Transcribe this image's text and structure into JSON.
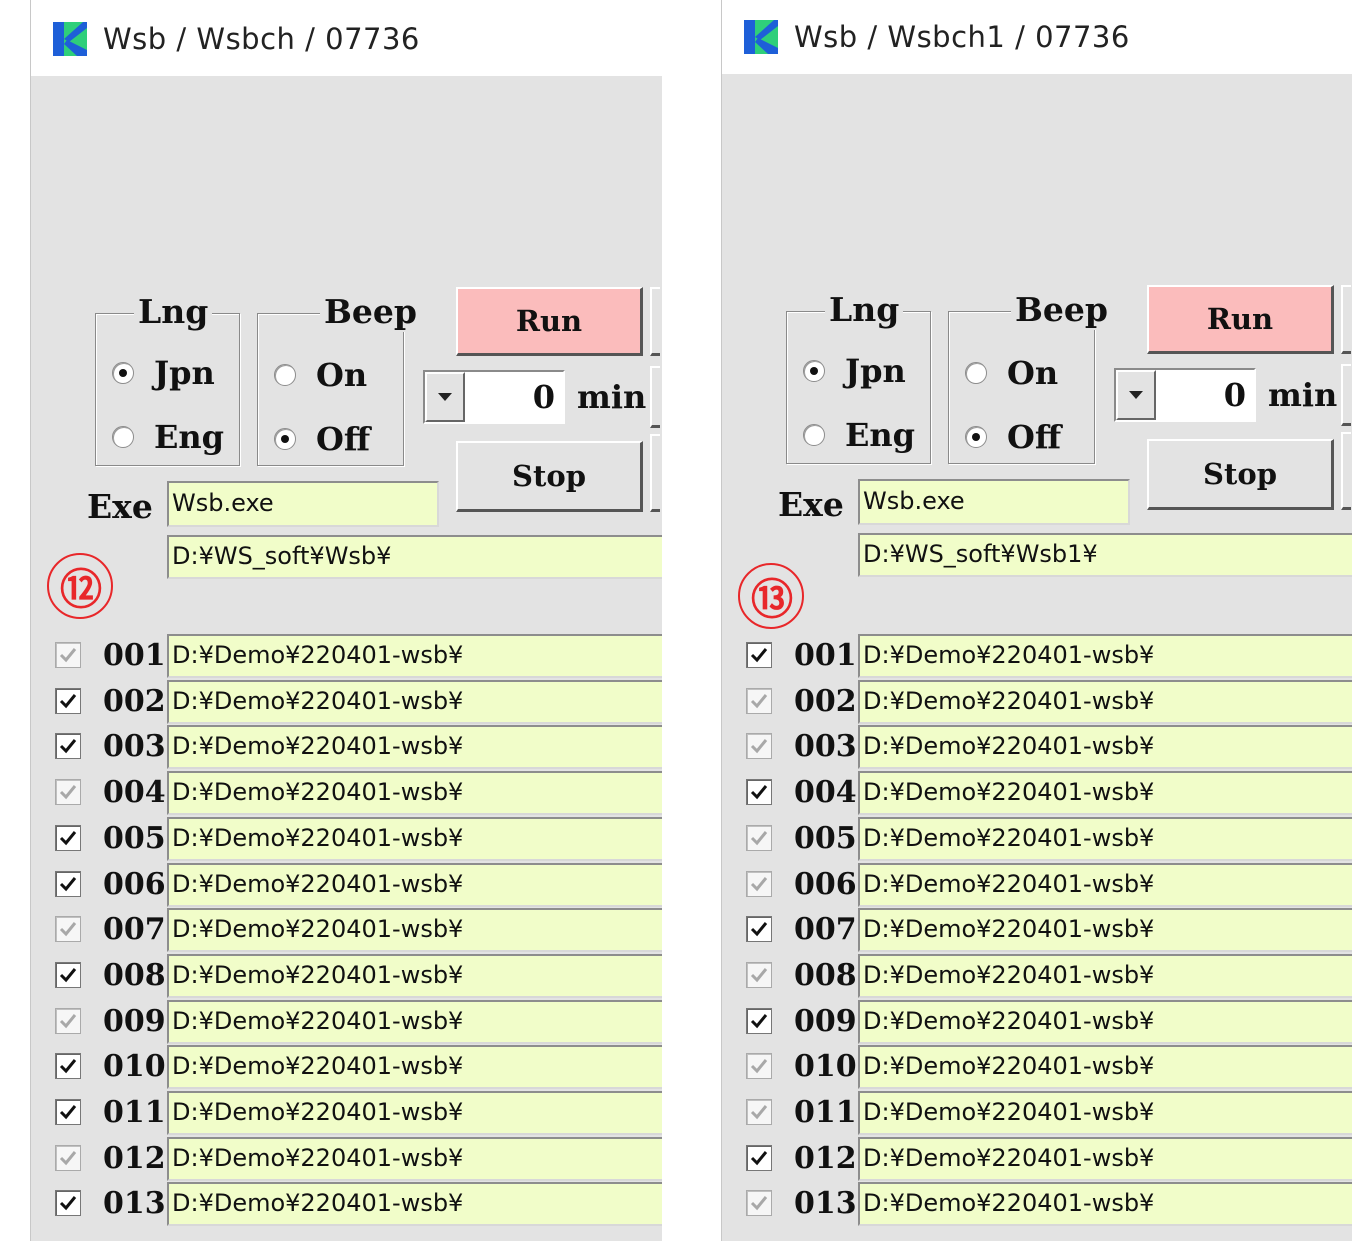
{
  "windows": [
    {
      "title": "Wsb / Wsbch / 07736",
      "marker": "⑫",
      "lng": {
        "title": "Lng",
        "options": [
          "Jpn",
          "Eng"
        ],
        "selected": 0
      },
      "beep": {
        "title": "Beep",
        "options": [
          "On",
          "Off"
        ],
        "selected": 1
      },
      "run_label": "Run",
      "stop_label": "Stop",
      "timer": {
        "value": "0",
        "unit": "min"
      },
      "exe": {
        "label": "Exe",
        "file": "Wsb.exe",
        "path": "D:¥WS_soft¥Wsb¥"
      },
      "rows": [
        {
          "num": "001",
          "path": "D:¥Demo¥220401-wsb¥",
          "checked": false
        },
        {
          "num": "002",
          "path": "D:¥Demo¥220401-wsb¥",
          "checked": true
        },
        {
          "num": "003",
          "path": "D:¥Demo¥220401-wsb¥",
          "checked": true
        },
        {
          "num": "004",
          "path": "D:¥Demo¥220401-wsb¥",
          "checked": false
        },
        {
          "num": "005",
          "path": "D:¥Demo¥220401-wsb¥",
          "checked": true
        },
        {
          "num": "006",
          "path": "D:¥Demo¥220401-wsb¥",
          "checked": true
        },
        {
          "num": "007",
          "path": "D:¥Demo¥220401-wsb¥",
          "checked": false
        },
        {
          "num": "008",
          "path": "D:¥Demo¥220401-wsb¥",
          "checked": true
        },
        {
          "num": "009",
          "path": "D:¥Demo¥220401-wsb¥",
          "checked": false
        },
        {
          "num": "010",
          "path": "D:¥Demo¥220401-wsb¥",
          "checked": true
        },
        {
          "num": "011",
          "path": "D:¥Demo¥220401-wsb¥",
          "checked": true
        },
        {
          "num": "012",
          "path": "D:¥Demo¥220401-wsb¥",
          "checked": false
        },
        {
          "num": "013",
          "path": "D:¥Demo¥220401-wsb¥",
          "checked": true
        }
      ]
    },
    {
      "title": "Wsb / Wsbch1 / 07736",
      "marker": "⑬",
      "lng": {
        "title": "Lng",
        "options": [
          "Jpn",
          "Eng"
        ],
        "selected": 0
      },
      "beep": {
        "title": "Beep",
        "options": [
          "On",
          "Off"
        ],
        "selected": 1
      },
      "run_label": "Run",
      "stop_label": "Stop",
      "timer": {
        "value": "0",
        "unit": "min"
      },
      "exe": {
        "label": "Exe",
        "file": "Wsb.exe",
        "path": "D:¥WS_soft¥Wsb1¥"
      },
      "rows": [
        {
          "num": "001",
          "path": "D:¥Demo¥220401-wsb¥",
          "checked": true
        },
        {
          "num": "002",
          "path": "D:¥Demo¥220401-wsb¥",
          "checked": false
        },
        {
          "num": "003",
          "path": "D:¥Demo¥220401-wsb¥",
          "checked": false
        },
        {
          "num": "004",
          "path": "D:¥Demo¥220401-wsb¥",
          "checked": true
        },
        {
          "num": "005",
          "path": "D:¥Demo¥220401-wsb¥",
          "checked": false
        },
        {
          "num": "006",
          "path": "D:¥Demo¥220401-wsb¥",
          "checked": false
        },
        {
          "num": "007",
          "path": "D:¥Demo¥220401-wsb¥",
          "checked": true
        },
        {
          "num": "008",
          "path": "D:¥Demo¥220401-wsb¥",
          "checked": false
        },
        {
          "num": "009",
          "path": "D:¥Demo¥220401-wsb¥",
          "checked": true
        },
        {
          "num": "010",
          "path": "D:¥Demo¥220401-wsb¥",
          "checked": false
        },
        {
          "num": "011",
          "path": "D:¥Demo¥220401-wsb¥",
          "checked": false
        },
        {
          "num": "012",
          "path": "D:¥Demo¥220401-wsb¥",
          "checked": true
        },
        {
          "num": "013",
          "path": "D:¥Demo¥220401-wsb¥",
          "checked": false
        }
      ]
    }
  ],
  "colors": {
    "run_button": "#fbbcbc",
    "path_field": "#f1fdc9",
    "client_bg": "#e3e3e3",
    "marker": "#e8272a",
    "logo_blue": "#1e5fd8",
    "logo_green": "#2fcf7a"
  },
  "icons": [
    "app-logo-icon",
    "chevron-down-icon",
    "check-icon"
  ]
}
